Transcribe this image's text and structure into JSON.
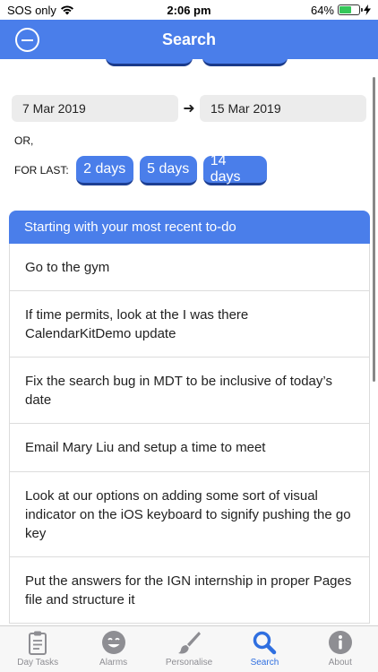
{
  "status_bar": {
    "carrier": "SOS only",
    "time": "2:06 pm",
    "battery": "64%",
    "battery_level": 0.64
  },
  "header": {
    "title": "Search"
  },
  "date_range": {
    "start": "7 Mar 2019",
    "arrow": "➜",
    "end": "15 Mar 2019"
  },
  "or_label": "OR,",
  "for_last": {
    "label": "FOR LAST:",
    "options": [
      "2 days",
      "5 days",
      "14 days"
    ]
  },
  "results": {
    "header": "Starting with your most recent to-do",
    "items": [
      "Go to the gym",
      "If time permits, look at the I was there CalendarKitDemo update",
      "Fix the search bug in MDT to be inclusive of today’s date",
      "Email Mary Liu and setup a time to meet",
      "Look at our options on adding some sort of visual indicator on the iOS keyboard to signify pushing the go key",
      "Put the answers for the IGN internship in proper Pages file and structure it"
    ]
  },
  "tabs": [
    {
      "label": "Day Tasks",
      "icon": "clipboard-icon",
      "active": false
    },
    {
      "label": "Alarms",
      "icon": "smiley-icon",
      "active": false
    },
    {
      "label": "Personalise",
      "icon": "paintbrush-icon",
      "active": false
    },
    {
      "label": "Search",
      "icon": "search-icon",
      "active": true
    },
    {
      "label": "About",
      "icon": "info-icon",
      "active": false
    }
  ],
  "colors": {
    "accent": "#4a7eea",
    "tab_active": "#2f6fe0",
    "battery_fill": "#34c759"
  }
}
